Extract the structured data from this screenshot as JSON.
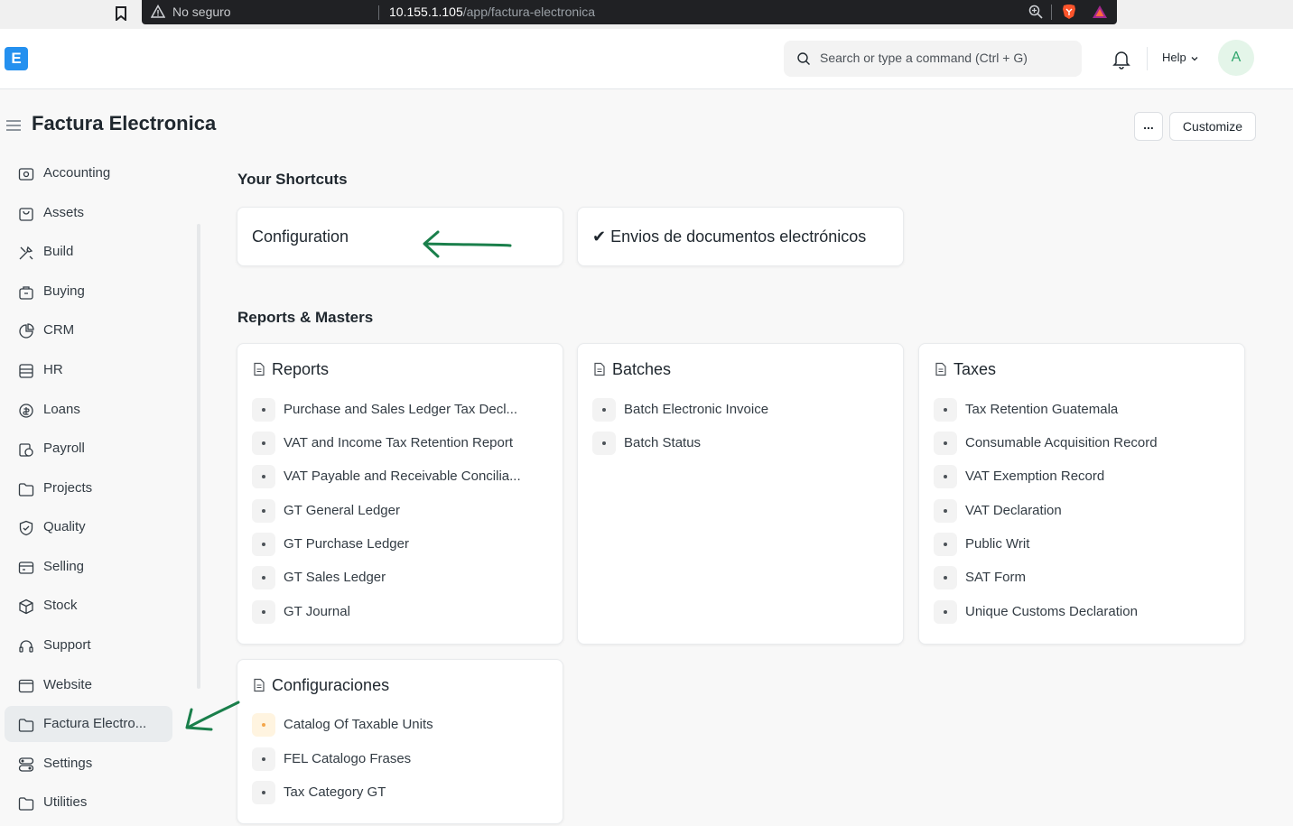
{
  "browser": {
    "security_label": "No seguro",
    "url_host": "10.155.1.105",
    "url_path": "/app/factura-electronica"
  },
  "navbar": {
    "logo_letter": "E",
    "search_placeholder": "Search or type a command (Ctrl + G)",
    "help_label": "Help",
    "avatar_initial": "A"
  },
  "page": {
    "title": "Factura Electronica",
    "more_label": "...",
    "customize_label": "Customize"
  },
  "sidebar": {
    "items": [
      {
        "label": "Accounting",
        "icon": "accounting-icon"
      },
      {
        "label": "Assets",
        "icon": "assets-icon"
      },
      {
        "label": "Build",
        "icon": "build-icon"
      },
      {
        "label": "Buying",
        "icon": "buying-icon"
      },
      {
        "label": "CRM",
        "icon": "crm-icon"
      },
      {
        "label": "HR",
        "icon": "hr-icon"
      },
      {
        "label": "Loans",
        "icon": "loans-icon"
      },
      {
        "label": "Payroll",
        "icon": "payroll-icon"
      },
      {
        "label": "Projects",
        "icon": "folder-icon"
      },
      {
        "label": "Quality",
        "icon": "quality-icon"
      },
      {
        "label": "Selling",
        "icon": "selling-icon"
      },
      {
        "label": "Stock",
        "icon": "stock-icon"
      },
      {
        "label": "Support",
        "icon": "headset-icon"
      },
      {
        "label": "Website",
        "icon": "website-icon"
      },
      {
        "label": "Factura Electro...",
        "icon": "folder-icon",
        "active": true
      },
      {
        "label": "Settings",
        "icon": "settings-icon"
      },
      {
        "label": "Utilities",
        "icon": "folder-icon"
      }
    ]
  },
  "shortcuts": {
    "heading": "Your Shortcuts",
    "items": [
      {
        "label": "Configuration"
      },
      {
        "label": "✔ Envios de documentos electrónicos"
      }
    ]
  },
  "reports": {
    "heading": "Reports & Masters",
    "cards": [
      {
        "title": "Reports",
        "links": [
          "Purchase and Sales Ledger Tax Decl...",
          "VAT and Income Tax Retention Report",
          "VAT Payable and Receivable Concilia...",
          "GT General Ledger",
          "GT Purchase Ledger",
          "GT Sales Ledger",
          "GT Journal"
        ]
      },
      {
        "title": "Batches",
        "links": [
          "Batch Electronic Invoice",
          "Batch Status"
        ]
      },
      {
        "title": "Taxes",
        "links": [
          "Tax Retention Guatemala",
          "Consumable Acquisition Record",
          "VAT Exemption Record",
          "VAT Declaration",
          "Public Writ",
          "SAT Form",
          "Unique Customs Declaration"
        ]
      },
      {
        "title": "Configuraciones",
        "links": [
          "Catalog Of Taxable Units",
          "FEL Catalogo Frases",
          "Tax Category GT"
        ]
      }
    ]
  },
  "colors": {
    "accent": "#2490ef",
    "annotation_arrow": "#1a7f4b",
    "warn_dot": "#f4a64b"
  }
}
